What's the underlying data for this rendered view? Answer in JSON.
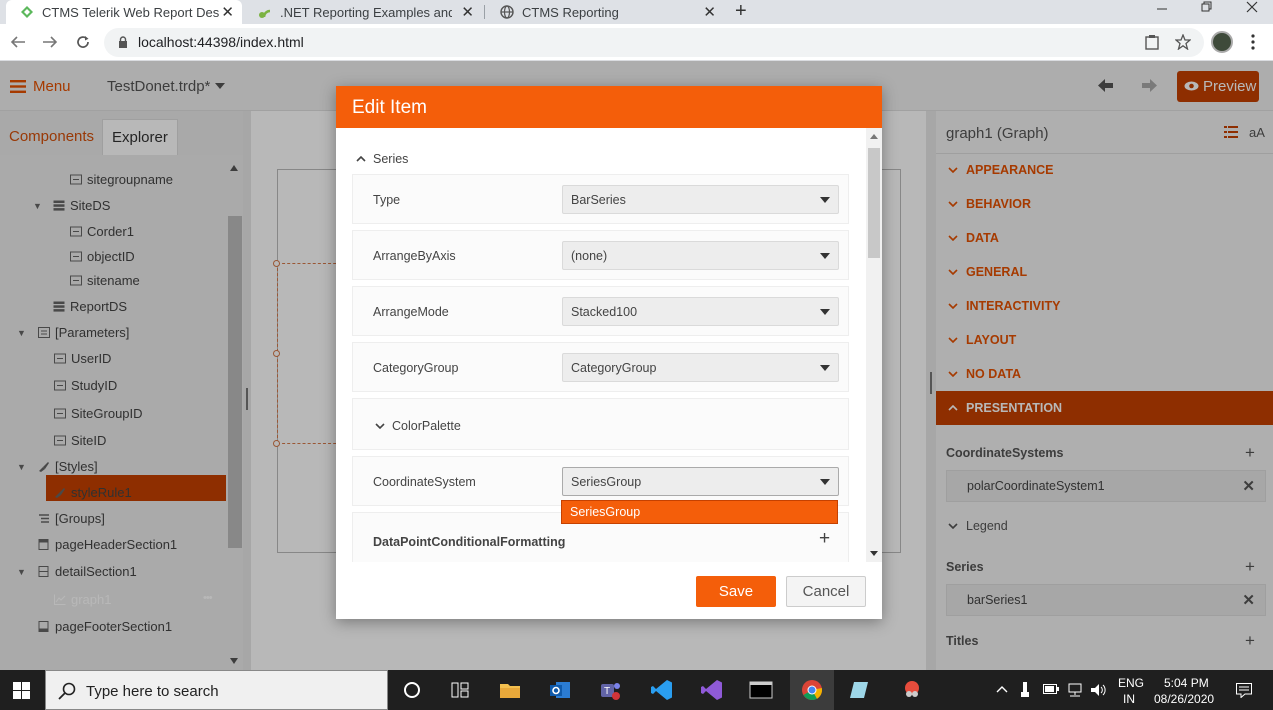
{
  "browser": {
    "tabs": [
      {
        "title": "CTMS Telerik Web Report Design",
        "active": true
      },
      {
        "title": ".NET Reporting Examples and De",
        "active": false
      },
      {
        "title": "CTMS Reporting",
        "active": false
      }
    ],
    "url": "localhost:44398/index.html",
    "new_tab_symbol": "+",
    "close_symbol": "✕"
  },
  "app": {
    "menu_label": "Menu",
    "report_file": "TestDonet.trdp*",
    "preview_label": "Preview",
    "panel_tabs": {
      "components": "Components",
      "explorer": "Explorer"
    },
    "tree": [
      "sitegroupname",
      "SiteDS",
      "Corder1",
      "objectID",
      "sitename",
      "ReportDS",
      "[Parameters]",
      "UserID",
      "StudyID",
      "SiteGroupID",
      "SiteID",
      "[Styles]",
      "styleRule1",
      "[Groups]",
      "pageHeaderSection1",
      "detailSection1",
      "graph1",
      "pageFooterSection1"
    ],
    "selected_item_more": "•••"
  },
  "properties": {
    "title": "graph1 (Graph)",
    "text_size_label": "aA",
    "categories": [
      "APPEARANCE",
      "BEHAVIOR",
      "DATA",
      "GENERAL",
      "INTERACTIVITY",
      "LAYOUT",
      "NO DATA",
      "PRESENTATION"
    ],
    "coordinate_systems_label": "CoordinateSystems",
    "coordinate_system_item": "polarCoordinateSystem1",
    "legend_label": "Legend",
    "series_label": "Series",
    "series_item": "barSeries1",
    "titles_label": "Titles",
    "plus": "+",
    "remove": "✕"
  },
  "modal": {
    "title": "Edit Item",
    "section_series": "Series",
    "rows": [
      {
        "label": "Type",
        "value": "BarSeries"
      },
      {
        "label": "ArrangeByAxis",
        "value": "(none)"
      },
      {
        "label": "ArrangeMode",
        "value": "Stacked100"
      },
      {
        "label": "CategoryGroup",
        "value": "CategoryGroup"
      }
    ],
    "color_palette": "ColorPalette",
    "coordinate_system": {
      "label": "CoordinateSystem",
      "value": "SeriesGroup",
      "open_option": "SeriesGroup"
    },
    "data_point_cf": "DataPointConditionalFormatting",
    "plus": "+",
    "save": "Save",
    "cancel": "Cancel"
  },
  "taskbar": {
    "search_placeholder": "Type here to search",
    "lang_line1": "ENG",
    "lang_line2": "IN",
    "time": "5:04 PM",
    "date": "08/26/2020"
  },
  "colors": {
    "accent": "#f45e0a",
    "accent_dark": "#c54100"
  }
}
